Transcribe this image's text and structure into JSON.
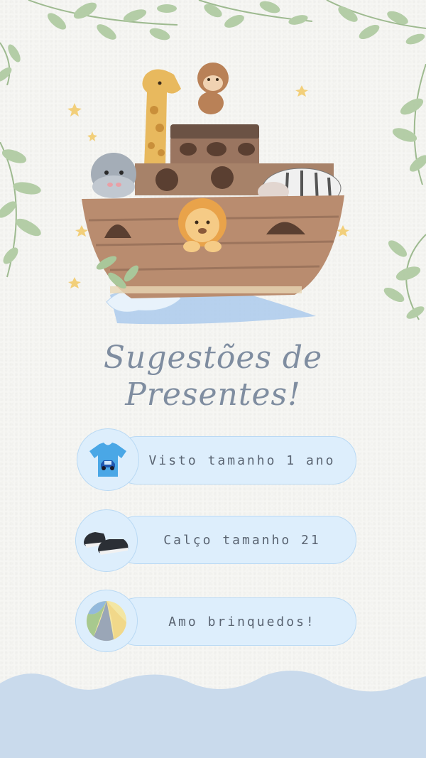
{
  "title": {
    "line1": "Sugestões de",
    "line2": "Presentes!"
  },
  "gifts": [
    {
      "label": "Visto tamanho 1 ano",
      "icon": "tshirt-icon"
    },
    {
      "label": "Calço tamanho 21",
      "icon": "shoes-icon"
    },
    {
      "label": "Amo brinquedos!",
      "icon": "beach-ball-icon"
    }
  ],
  "illustration": {
    "icon": "noahs-ark-animals-icon"
  },
  "colors": {
    "pill": "#ddeefc",
    "pill_border": "#b9d9f4",
    "title": "#7f8da0",
    "text": "#5a6472",
    "wave": "#c9daec"
  }
}
